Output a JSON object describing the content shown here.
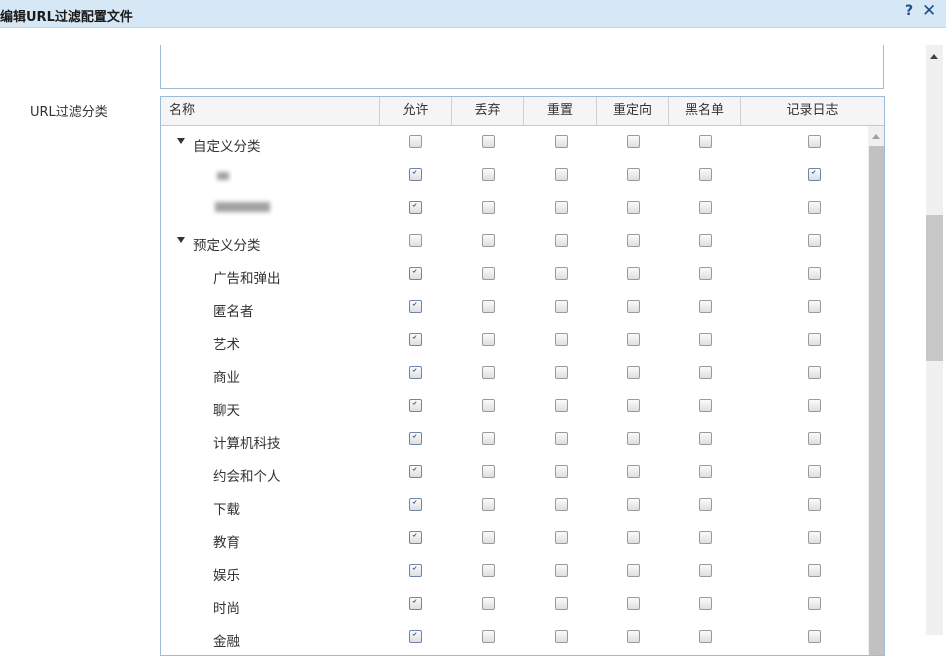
{
  "dialog": {
    "title": "编辑URL过滤配置文件",
    "help_label": "?",
    "close_label": "✕"
  },
  "form": {
    "category_label": "URL过滤分类"
  },
  "table": {
    "columns": [
      "名称",
      "允许",
      "丢弃",
      "重置",
      "重定向",
      "黑名单",
      "记录日志"
    ],
    "rows": [
      {
        "name": "自定义分类",
        "group": true,
        "checks": [
          false,
          false,
          false,
          false,
          false,
          false
        ]
      },
      {
        "name": "",
        "redacted": true,
        "checks": [
          true,
          false,
          false,
          false,
          false,
          true
        ]
      },
      {
        "name": "",
        "redacted": true,
        "checks": [
          true,
          false,
          false,
          false,
          false,
          false
        ]
      },
      {
        "name": "预定义分类",
        "group": true,
        "checks": [
          false,
          false,
          false,
          false,
          false,
          false
        ]
      },
      {
        "name": "广告和弹出",
        "checks": [
          true,
          false,
          false,
          false,
          false,
          false
        ]
      },
      {
        "name": "匿名者",
        "checks": [
          true,
          false,
          false,
          false,
          false,
          false
        ]
      },
      {
        "name": "艺术",
        "checks": [
          true,
          false,
          false,
          false,
          false,
          false
        ]
      },
      {
        "name": "商业",
        "checks": [
          true,
          false,
          false,
          false,
          false,
          false
        ]
      },
      {
        "name": "聊天",
        "checks": [
          true,
          false,
          false,
          false,
          false,
          false
        ]
      },
      {
        "name": "计算机科技",
        "checks": [
          true,
          false,
          false,
          false,
          false,
          false
        ]
      },
      {
        "name": "约会和个人",
        "checks": [
          true,
          false,
          false,
          false,
          false,
          false
        ]
      },
      {
        "name": "下载",
        "checks": [
          true,
          false,
          false,
          false,
          false,
          false
        ]
      },
      {
        "name": "教育",
        "checks": [
          true,
          false,
          false,
          false,
          false,
          false
        ]
      },
      {
        "name": "娱乐",
        "checks": [
          true,
          false,
          false,
          false,
          false,
          false
        ]
      },
      {
        "name": "时尚",
        "checks": [
          true,
          false,
          false,
          false,
          false,
          false
        ]
      },
      {
        "name": "金融",
        "checks": [
          true,
          false,
          false,
          false,
          false,
          false
        ]
      }
    ]
  },
  "colors": {
    "titlebar": "#d6e7f5",
    "border": "#9fbcd6",
    "check_tick": "#2c4f84"
  },
  "icons": {
    "close": "close-icon",
    "help": "help-icon",
    "expander": "tree-collapse-icon"
  }
}
